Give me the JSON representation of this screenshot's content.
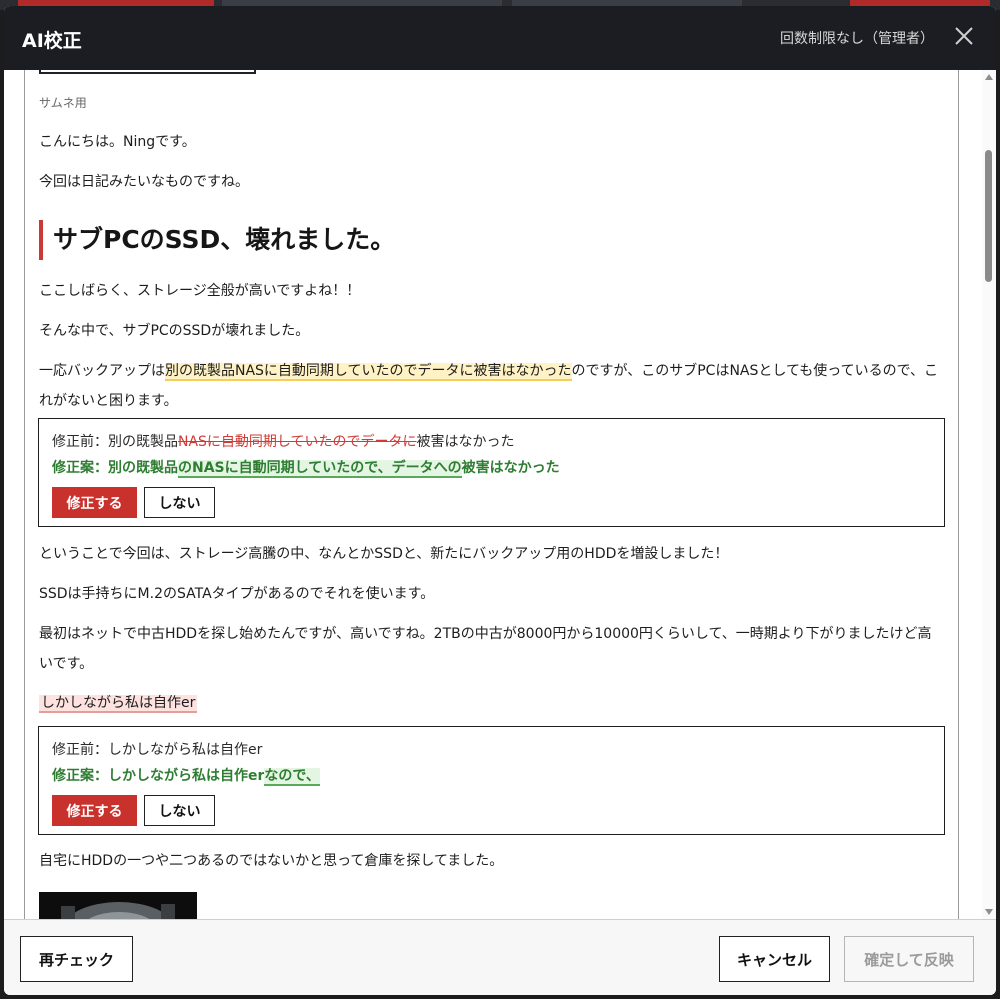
{
  "modal": {
    "title": "AI校正",
    "limit_label": "回数制限なし（管理者）"
  },
  "content": {
    "caption": "サムネ用",
    "p1": "こんにちは。Ningです。",
    "p2": "今回は日記みたいなものですね。",
    "heading": "サブPCのSSD、壊れました。",
    "p3": "ここしばらく、ストレージ全般が高いですよね！！",
    "p4": "そんな中で、サブPCのSSDが壊れました。",
    "p5_before": "一応バックアップは",
    "p5_highlight": "別の既製品NASに自動同期していたのでデータに被害はなかった",
    "p5_after": "のですが、このサブPCはNASとしても使っているので、これがないと困ります。",
    "p6": "ということで今回は、ストレージ高騰の中、なんとかSSDと、新たにバックアップ用のHDDを増設しました！",
    "p7": "SSDは手持ちにM.2のSATAタイプがあるのでそれを使います。",
    "p8": "最初はネットで中古HDDを探し始めたんですが、高いですね。2TBの中古が8000円から10000円くらいして、一時期より下がりましたけど高いです。",
    "p9_highlight": "しかしながら私は自作er",
    "p10": "自宅にHDDの一つや二つあるのではないかと思って倉庫を探してました。"
  },
  "corrections": [
    {
      "before_prefix": "修正前：別の既製品",
      "before_deleted": "NASに自動同期していたのでデータに",
      "before_suffix": "被害はなかった",
      "after_prefix": "修正案：別の既製品",
      "after_inserted": "のNASに自動同期していたので、データへの",
      "after_suffix": "被害はなかった",
      "apply_label": "修正する",
      "reject_label": "しない"
    },
    {
      "before_prefix": "修正前：しかしながら私は自作er",
      "after_prefix": "修正案：しかしながら私は自作er",
      "after_inserted": "なので、",
      "apply_label": "修正する",
      "reject_label": "しない"
    }
  ],
  "footer": {
    "recheck_label": "再チェック",
    "cancel_label": "キャンセル",
    "confirm_label": "確定して反映"
  }
}
